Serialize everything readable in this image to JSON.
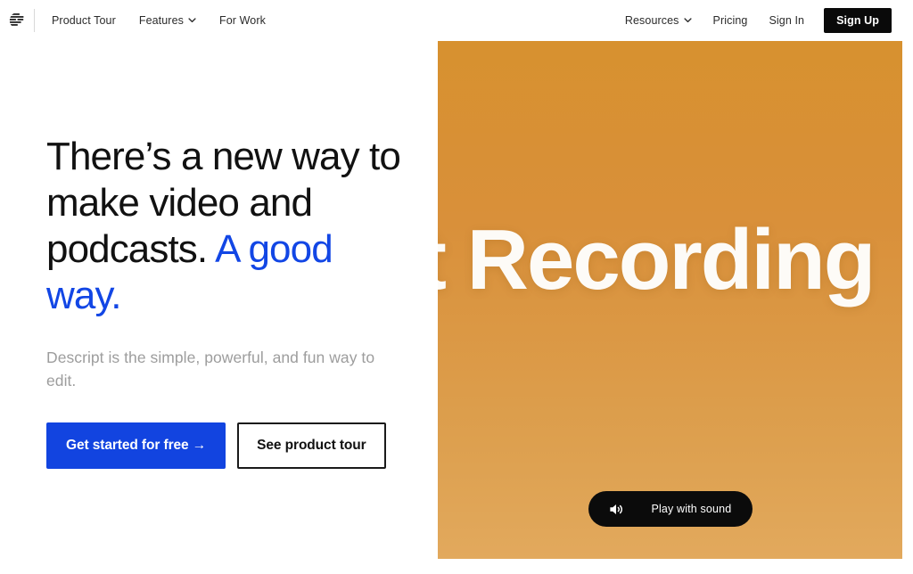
{
  "nav": {
    "logo_icon": "descript-logo-icon",
    "left_links": [
      {
        "label": "Product Tour",
        "has_dropdown": false
      },
      {
        "label": "Features",
        "has_dropdown": true
      },
      {
        "label": "For Work",
        "has_dropdown": false
      }
    ],
    "right_links": [
      {
        "label": "Resources",
        "has_dropdown": true
      },
      {
        "label": "Pricing",
        "has_dropdown": false
      },
      {
        "label": "Sign In",
        "has_dropdown": false
      }
    ],
    "signup_label": "Sign Up"
  },
  "hero": {
    "headline_part1": "There’s a new way to make video and podcasts. ",
    "headline_accent": "A good way.",
    "subhead": "Descript is the simple, powerful, and fun way to edit.",
    "primary_cta": "Get started for free →",
    "secondary_cta": "See product tour"
  },
  "video": {
    "overlay_text": "t Recording",
    "play_label": "Play with sound",
    "speaker_icon": "speaker-sound-icon"
  },
  "colors": {
    "accent_blue": "#1246e5",
    "button_blue": "#1244e0",
    "video_orange": "#d9903a",
    "black": "#0a0a0a",
    "muted_text": "#9d9d9d"
  }
}
